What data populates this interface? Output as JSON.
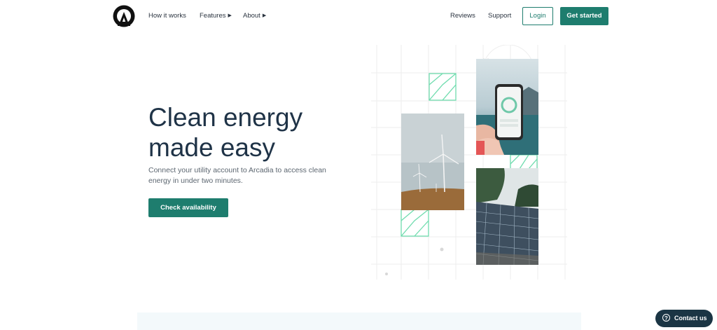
{
  "nav": {
    "links": [
      {
        "label": "How it works"
      },
      {
        "label": "Features",
        "has_caret": true
      },
      {
        "label": "About",
        "has_caret": true
      }
    ],
    "right_links": [
      {
        "label": "Reviews"
      },
      {
        "label": "Support"
      }
    ],
    "login_label": "Login",
    "get_started_label": "Get started"
  },
  "hero": {
    "title_line1": "Clean energy",
    "title_line2": "made easy",
    "subtitle": "Connect your utility account to Arcadia to access clean energy in under two minutes.",
    "cta_label": "Check availability"
  },
  "contact": {
    "label": "Contact us",
    "icon": "question-icon"
  },
  "colors": {
    "brand_green": "#1e7d6e",
    "heading": "#1f3347",
    "accent_pattern": "#6fdcae",
    "contact_bg": "#1b3544"
  }
}
